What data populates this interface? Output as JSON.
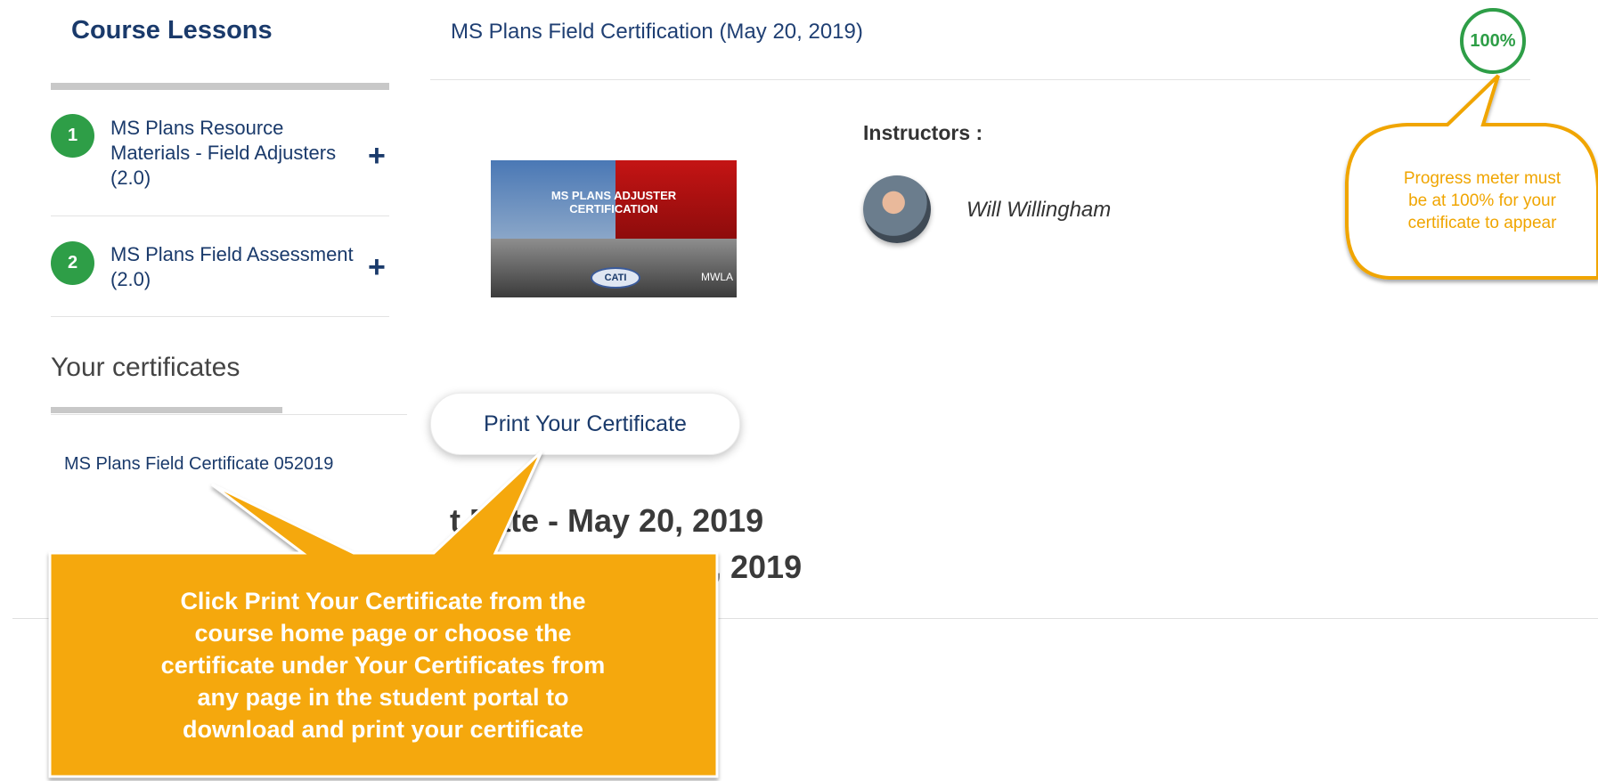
{
  "sidebar": {
    "title": "Course Lessons",
    "lessons": [
      {
        "number": "1",
        "label_lines": [
          "MS Plans Resource",
          "Materials - Field Adjusters",
          "(2.0)"
        ]
      },
      {
        "number": "2",
        "label_lines": [
          "MS Plans Field Assessment",
          "(2.0)"
        ]
      }
    ],
    "certificates_title": "Your certificates",
    "certificate_link": "MS Plans Field Certificate 052019"
  },
  "main": {
    "course_title": "MS Plans Field Certification (May 20, 2019)",
    "progress": {
      "value_percent": 100,
      "label": "100%"
    },
    "thumbnail": {
      "title_line1": "MS PLANS ADJUSTER",
      "title_line2": "CERTIFICATION",
      "logo_text": "CATI",
      "logo2_text": "MWLA"
    },
    "instructors_label": "Instructors :",
    "instructor_name": "Will Willingham",
    "print_button": "Print Your Certificate",
    "start_date_visible": "t Date - May 20, 2019",
    "end_date_visible": ", 2019"
  },
  "callouts": {
    "main_lines": [
      "Click Print Your Certificate from the",
      "course home page or choose the",
      "certificate under Your Certificates from",
      "any page in the student portal to",
      "download and print your certificate"
    ],
    "progress_lines": [
      "Progress meter must",
      "be at 100% for your",
      "certificate to appear"
    ]
  },
  "colors": {
    "brand_navy": "#1a3a6b",
    "progress_green": "#2e9e47",
    "callout_orange": "#f5a80c",
    "callout_text_orange": "#f0a500"
  }
}
